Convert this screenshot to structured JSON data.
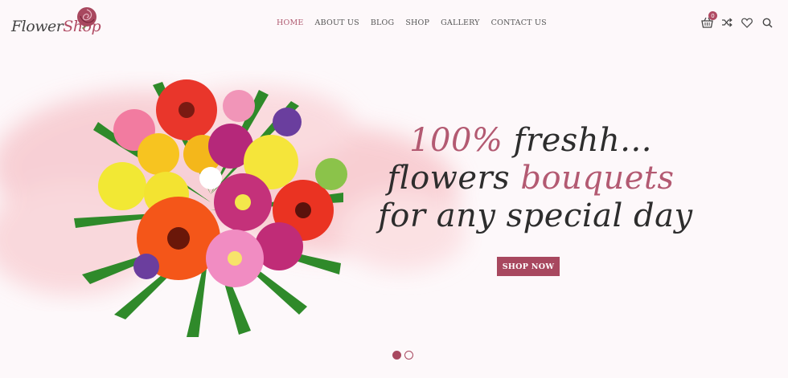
{
  "brand": {
    "logo_part1": "Flower",
    "logo_part2": "Shop",
    "accent_color": "#a8485f"
  },
  "nav": {
    "items": [
      {
        "label": "HOME",
        "active": true
      },
      {
        "label": "ABOUT US",
        "active": false
      },
      {
        "label": "BLOG",
        "active": false
      },
      {
        "label": "SHOP",
        "active": false
      },
      {
        "label": "GALLERY",
        "active": false
      },
      {
        "label": "CONTACT US",
        "active": false
      }
    ]
  },
  "header_icons": {
    "cart_icon": "basket-icon",
    "cart_count": "0",
    "compare_icon": "shuffle-icon",
    "wishlist_icon": "heart-icon",
    "search_icon": "search-icon"
  },
  "hero": {
    "line1_accent": "100%",
    "line1_rest": " freshh...",
    "line2_start": "flowers ",
    "line2_accent": "bouquets",
    "line3": "for any special day",
    "cta_label": "SHOP NOW"
  },
  "slider": {
    "slide_count": 2,
    "active_index": 0
  }
}
